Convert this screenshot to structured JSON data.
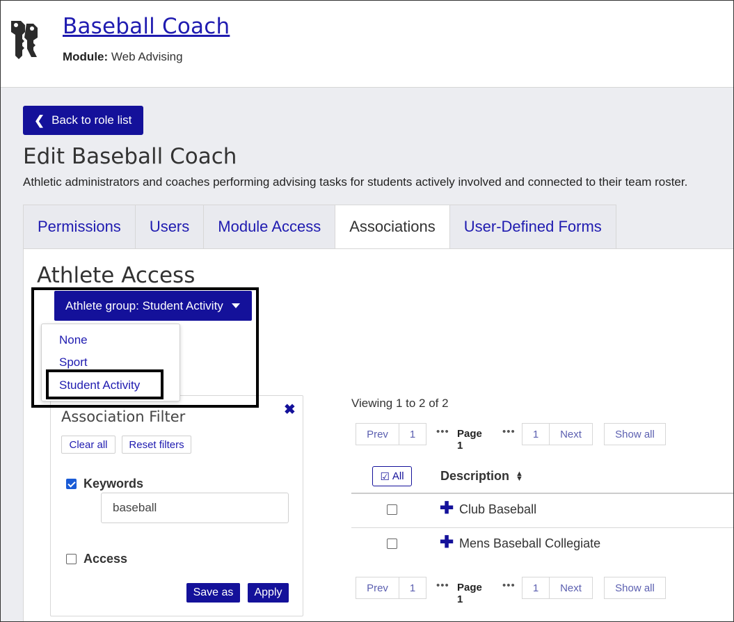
{
  "header": {
    "title": "Baseball Coach",
    "module_label": "Module:",
    "module_value": "Web Advising",
    "icon": "key-icon"
  },
  "back_button": {
    "label": "Back to role list",
    "icon": "chevron-left-icon"
  },
  "page": {
    "title": "Edit Baseball Coach",
    "description": "Athletic administrators and coaches performing advising tasks for students actively involved and connected to their team roster."
  },
  "tabs": [
    {
      "label": "Permissions"
    },
    {
      "label": "Users"
    },
    {
      "label": "Module Access"
    },
    {
      "label": "Associations",
      "active": true
    },
    {
      "label": "User-Defined Forms"
    }
  ],
  "section": {
    "title": "Athlete Access"
  },
  "group_select": {
    "label": "Athlete group: Student Activity",
    "options": [
      "None",
      "Sport",
      "Student Activity"
    ],
    "selected": "Student Activity"
  },
  "filter": {
    "title": "Association Filter",
    "clear_all": "Clear all",
    "reset_filters": "Reset filters",
    "keywords_label": "Keywords",
    "keywords_checked": true,
    "keywords_value": "baseball",
    "access_label": "Access",
    "access_checked": false,
    "save_as": "Save as",
    "apply": "Apply"
  },
  "results": {
    "viewing": "Viewing 1 to 2 of 2",
    "pager": {
      "prev": "Prev",
      "first": "1",
      "ellipsis": "•••",
      "current": "Page 1",
      "last": "1",
      "next": "Next",
      "show_all": "Show all"
    },
    "select_all": "All",
    "column_description": "Description",
    "rows": [
      {
        "description": "Club Baseball"
      },
      {
        "description": "Mens Baseball Collegiate"
      }
    ]
  },
  "colors": {
    "primary": "#14119a",
    "link": "#1f1bb0",
    "background": "#ecedf1"
  }
}
